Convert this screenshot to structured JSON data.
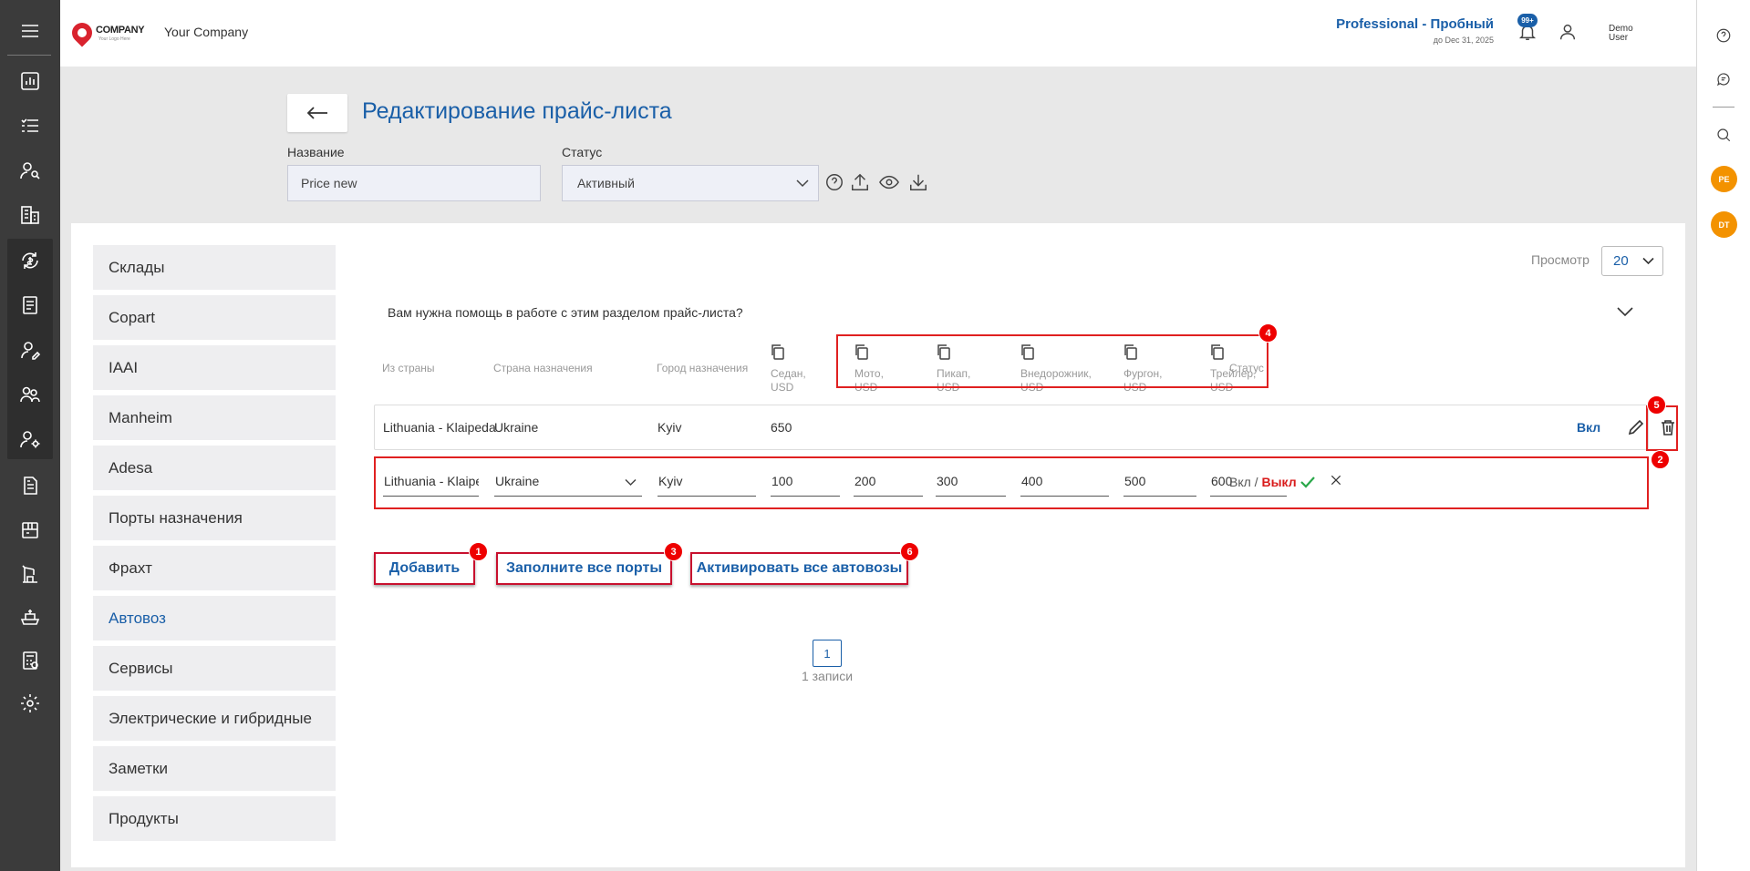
{
  "header": {
    "logo_text": "COMPANY",
    "logo_sub": "Your Logo Here",
    "company_name": "Your Company",
    "plan": "Professional - Пробный",
    "plan_until": "до Dec 31, 2025",
    "notifications_badge": "99+",
    "user_name": "Demo User"
  },
  "page": {
    "title": "Редактирование прайс-листа",
    "name_label": "Название",
    "name_value": "Price new",
    "status_label": "Статус",
    "status_value": "Активный"
  },
  "sidebar": {
    "items": [
      {
        "label": "Склады"
      },
      {
        "label": "Copart"
      },
      {
        "label": "IAAI"
      },
      {
        "label": "Manheim"
      },
      {
        "label": "Adesa"
      },
      {
        "label": "Порты назначения"
      },
      {
        "label": "Фрахт"
      },
      {
        "label": "Автовоз",
        "active": true
      },
      {
        "label": "Сервисы"
      },
      {
        "label": "Электрические и гибридные"
      },
      {
        "label": "Заметки"
      },
      {
        "label": "Продукты"
      }
    ]
  },
  "view": {
    "label": "Просмотр",
    "value": "20"
  },
  "help": {
    "text": "Вам нужна помощь в работе с этим разделом прайс-листа?"
  },
  "table": {
    "columns": {
      "from": "Из страны",
      "to_country": "Страна назначения",
      "to_city": "Город назначения",
      "status": "Статус"
    },
    "price_columns": [
      {
        "line1": "Седан,",
        "line2": "USD"
      },
      {
        "line1": "Мото,",
        "line2": "USD"
      },
      {
        "line1": "Пикап,",
        "line2": "USD"
      },
      {
        "line1": "Внедорожник,",
        "line2": "USD"
      },
      {
        "line1": "Фургон,",
        "line2": "USD"
      },
      {
        "line1": "Трейлер,",
        "line2": "USD"
      }
    ],
    "row": {
      "from": "Lithuania - Klaipeda",
      "to_country": "Ukraine",
      "to_city": "Kyiv",
      "sedan": "650",
      "status": "Вкл"
    },
    "edit_row": {
      "from": "Lithuania - Klaipeda",
      "to_country": "Ukraine",
      "to_city": "Kyiv",
      "prices": [
        "100",
        "200",
        "300",
        "400",
        "500",
        "600"
      ],
      "status_on": "Вкл",
      "status_sep": " / ",
      "status_off": "Выкл"
    }
  },
  "actions": {
    "add": "Добавить",
    "fill_ports": "Заполните все порты",
    "activate_all": "Активировать все автовозы"
  },
  "badges": [
    "1",
    "2",
    "3",
    "4",
    "5",
    "6"
  ],
  "pagination": {
    "current": "1",
    "records": "1 записи"
  },
  "right_bar": {
    "avatars": [
      "PE",
      "DT"
    ]
  },
  "colors": {
    "accent": "#1a5fa8",
    "callout": "#e02020",
    "nav": "#3b3b3b",
    "avatar": "#f39200"
  }
}
